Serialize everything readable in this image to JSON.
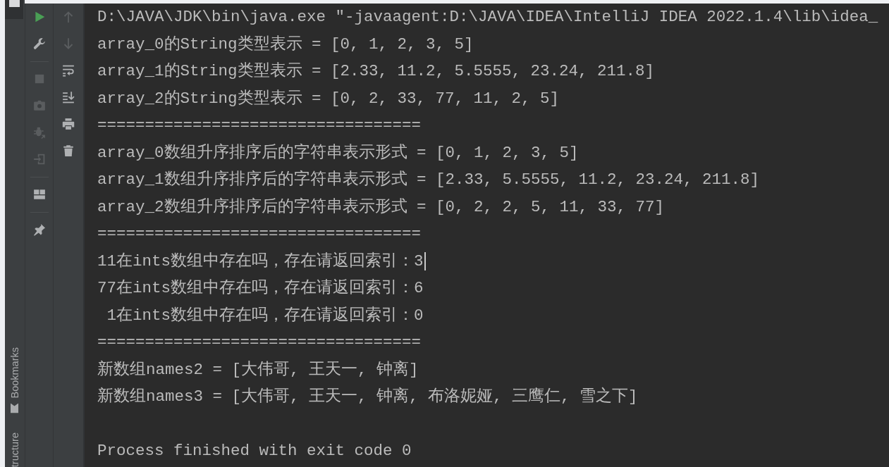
{
  "sidebar": {
    "side_tabs": [
      {
        "label": "Bookmarks",
        "icon": true
      },
      {
        "label": "tructure",
        "icon": false
      }
    ]
  },
  "run_toolbar": {
    "groups": [
      [
        {
          "disabled": false
        },
        {
          "disabled": false
        }
      ],
      [
        {
          "disabled": true
        },
        {
          "disabled": true
        },
        {
          "disabled": true
        },
        {
          "disabled": true
        }
      ],
      [
        {
          "disabled": false
        }
      ],
      [
        {
          "disabled": false
        }
      ]
    ]
  },
  "console_toolbar": {
    "buttons": [
      {
        "disabled": true
      },
      {
        "disabled": true
      },
      {
        "disabled": false
      },
      {
        "disabled": false
      },
      {
        "disabled": false
      },
      {
        "disabled": false
      }
    ]
  },
  "console": {
    "lines": [
      {
        "kind": "command",
        "text": "D:\\JAVA\\JDK\\bin\\java.exe \"-javaagent:D:\\JAVA\\IDEA\\IntelliJ IDEA 2022.1.4\\lib\\idea_",
        "caret": false
      },
      {
        "kind": "output",
        "text": "array_0的String类型表示 = [0, 1, 2, 3, 5]",
        "caret": false
      },
      {
        "kind": "output",
        "text": "array_1的String类型表示 = [2.33, 11.2, 5.5555, 23.24, 211.8]",
        "caret": false
      },
      {
        "kind": "output",
        "text": "array_2的String类型表示 = [0, 2, 33, 77, 11, 2, 5]",
        "caret": false
      },
      {
        "kind": "output",
        "text": "==================================",
        "caret": false
      },
      {
        "kind": "output",
        "text": "array_0数组升序排序后的字符串表示形式 = [0, 1, 2, 3, 5]",
        "caret": false
      },
      {
        "kind": "output",
        "text": "array_1数组升序排序后的字符串表示形式 = [2.33, 5.5555, 11.2, 23.24, 211.8]",
        "caret": false
      },
      {
        "kind": "output",
        "text": "array_2数组升序排序后的字符串表示形式 = [0, 2, 2, 5, 11, 33, 77]",
        "caret": false
      },
      {
        "kind": "output",
        "text": "==================================",
        "caret": false
      },
      {
        "kind": "output",
        "text": "11在ints数组中存在吗，存在请返回索引：3",
        "caret": true
      },
      {
        "kind": "output",
        "text": "77在ints数组中存在吗，存在请返回索引：6",
        "caret": false
      },
      {
        "kind": "output",
        "text": " 1在ints数组中存在吗，存在请返回索引：0",
        "caret": false
      },
      {
        "kind": "output",
        "text": "==================================",
        "caret": false
      },
      {
        "kind": "output",
        "text": "新数组names2 = [大伟哥, 王天一, 钟离]",
        "caret": false
      },
      {
        "kind": "output",
        "text": "新数组names3 = [大伟哥, 王天一, 钟离, 布洛妮娅, 三鹰仁, 雪之下]",
        "caret": false
      },
      {
        "kind": "exit",
        "text": "Process finished with exit code 0",
        "caret": false
      }
    ]
  }
}
